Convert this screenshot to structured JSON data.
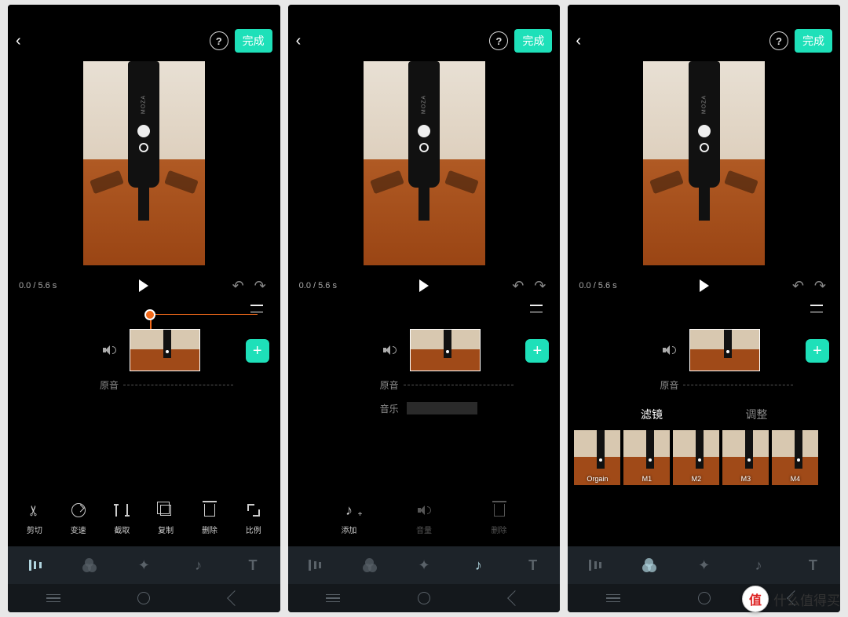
{
  "topbar": {
    "done": "完成"
  },
  "playbar": {
    "time": "0.0 / 5.6 s"
  },
  "tracks": {
    "original_audio": "原音",
    "music": "音乐"
  },
  "subtabs": {
    "filter": "滤镜",
    "adjust": "调整"
  },
  "filters": [
    {
      "label": "Orgain"
    },
    {
      "label": "M1"
    },
    {
      "label": "M2"
    },
    {
      "label": "M3"
    },
    {
      "label": "M4"
    }
  ],
  "tools_edit": [
    {
      "key": "cut",
      "label": "剪切"
    },
    {
      "key": "speed",
      "label": "变速"
    },
    {
      "key": "crop",
      "label": "截取"
    },
    {
      "key": "copy",
      "label": "复制"
    },
    {
      "key": "delete",
      "label": "删除"
    },
    {
      "key": "ratio",
      "label": "比例"
    }
  ],
  "tools_music": [
    {
      "key": "add",
      "label": "添加"
    },
    {
      "key": "volume",
      "label": "音量"
    },
    {
      "key": "delete",
      "label": "删除"
    }
  ],
  "watermark": {
    "badge": "值",
    "text": "什么值得买"
  }
}
